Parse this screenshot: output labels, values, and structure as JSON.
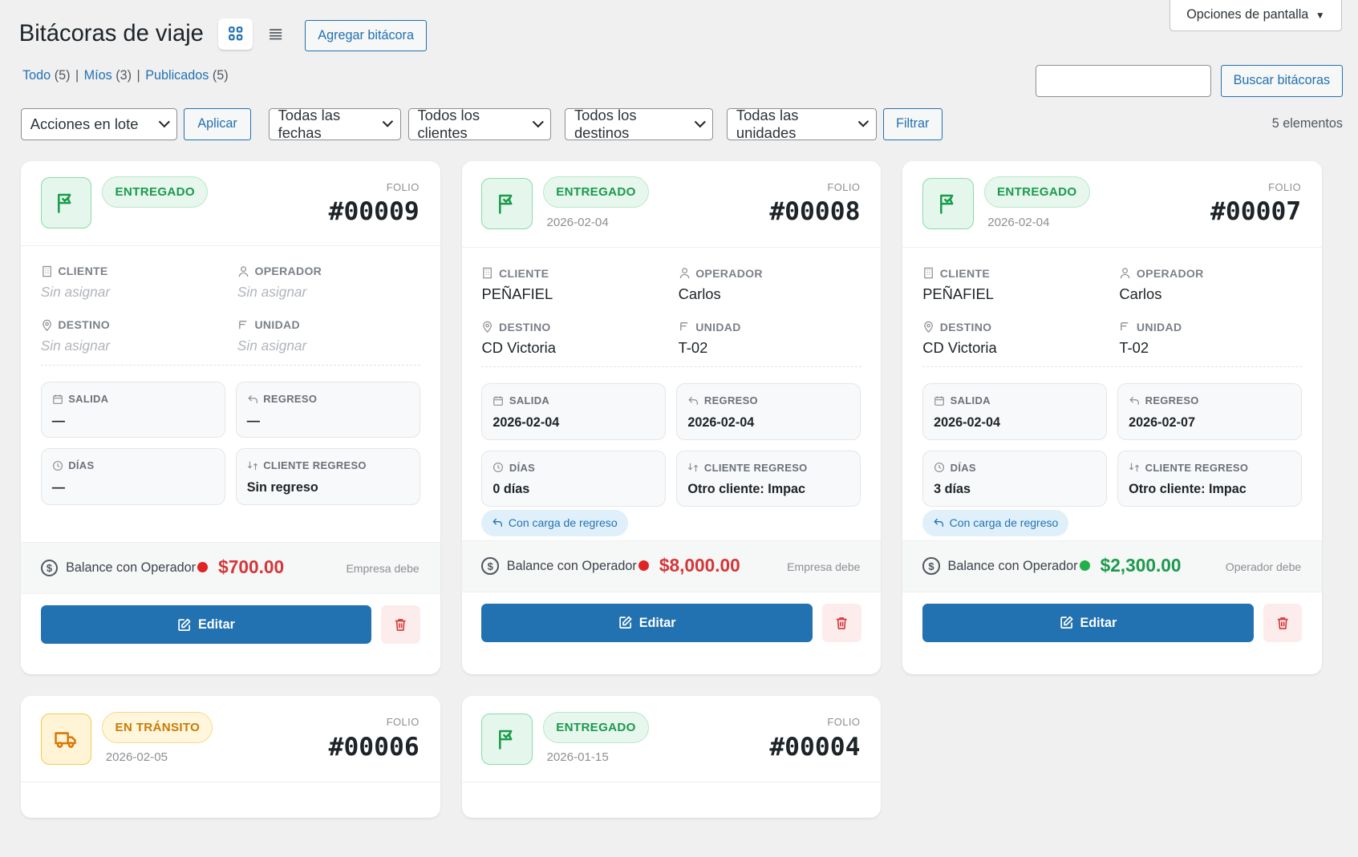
{
  "header": {
    "title": "Bitácoras de viaje",
    "add_label": "Agregar bitácora",
    "screen_options": "Opciones de pantalla"
  },
  "views": {
    "grid": "grid-icon",
    "list": "list-icon"
  },
  "filters": {
    "all": "Todo",
    "all_count": "(5)",
    "mine": "Míos",
    "mine_count": "(3)",
    "published": "Publicados",
    "published_count": "(5)",
    "bulk": "Acciones en lote",
    "apply": "Aplicar",
    "dates": "Todas las fechas",
    "clients": "Todos los clientes",
    "destinations": "Todos los destinos",
    "units": "Todas las unidades",
    "filter": "Filtrar",
    "search_button": "Buscar bitácoras",
    "search_value": "",
    "count": "5 elementos"
  },
  "labels": {
    "folio": "FOLIO",
    "cliente": "CLIENTE",
    "operador": "OPERADOR",
    "destino": "DESTINO",
    "unidad": "UNIDAD",
    "salida": "SALIDA",
    "regreso": "REGRESO",
    "dias": "DÍAS",
    "cliente_regreso": "CLIENTE REGRESO",
    "balance": "Balance con Operador",
    "edit": "Editar"
  },
  "cards": [
    {
      "status": "ENTREGADO",
      "status_color": "#1a9a4b",
      "date": "",
      "folio": "#00009",
      "cliente": "Sin asignar",
      "operador": "Sin asignar",
      "destino": "Sin asignar",
      "unidad": "Sin asignar",
      "salida": "—",
      "regreso": "—",
      "dias": "—",
      "cliente_regreso": "Sin regreso",
      "pill": "",
      "balance": "$700.00",
      "balance_color": "#d63638",
      "balance_note": "Empresa debe"
    },
    {
      "status": "ENTREGADO",
      "status_color": "#1a9a4b",
      "date": "2026-02-04",
      "folio": "#00008",
      "cliente": "PEÑAFIEL",
      "operador": "Carlos",
      "destino": "CD Victoria",
      "unidad": "T-02",
      "salida": "2026-02-04",
      "regreso": "2026-02-04",
      "dias": "0 días",
      "cliente_regreso": "Otro cliente: Impac",
      "pill": "Con carga de regreso",
      "balance": "$8,000.00",
      "balance_color": "#d63638",
      "balance_note": "Empresa debe"
    },
    {
      "status": "ENTREGADO",
      "status_color": "#1a9a4b",
      "date": "2026-02-04",
      "folio": "#00007",
      "cliente": "PEÑAFIEL",
      "operador": "Carlos",
      "destino": "CD Victoria",
      "unidad": "T-02",
      "salida": "2026-02-04",
      "regreso": "2026-02-07",
      "dias": "3 días",
      "cliente_regreso": "Otro cliente: Impac",
      "pill": "Con carga de regreso",
      "balance": "$2,300.00",
      "balance_color": "#1a9a4b",
      "balance_note": "Operador debe"
    },
    {
      "status": "EN TRÁNSITO",
      "status_color": "#c77b06",
      "date": "2026-02-05",
      "folio": "#00006"
    },
    {
      "status": "ENTREGADO",
      "status_color": "#1a9a4b",
      "date": "2026-01-15",
      "folio": "#00004"
    }
  ]
}
